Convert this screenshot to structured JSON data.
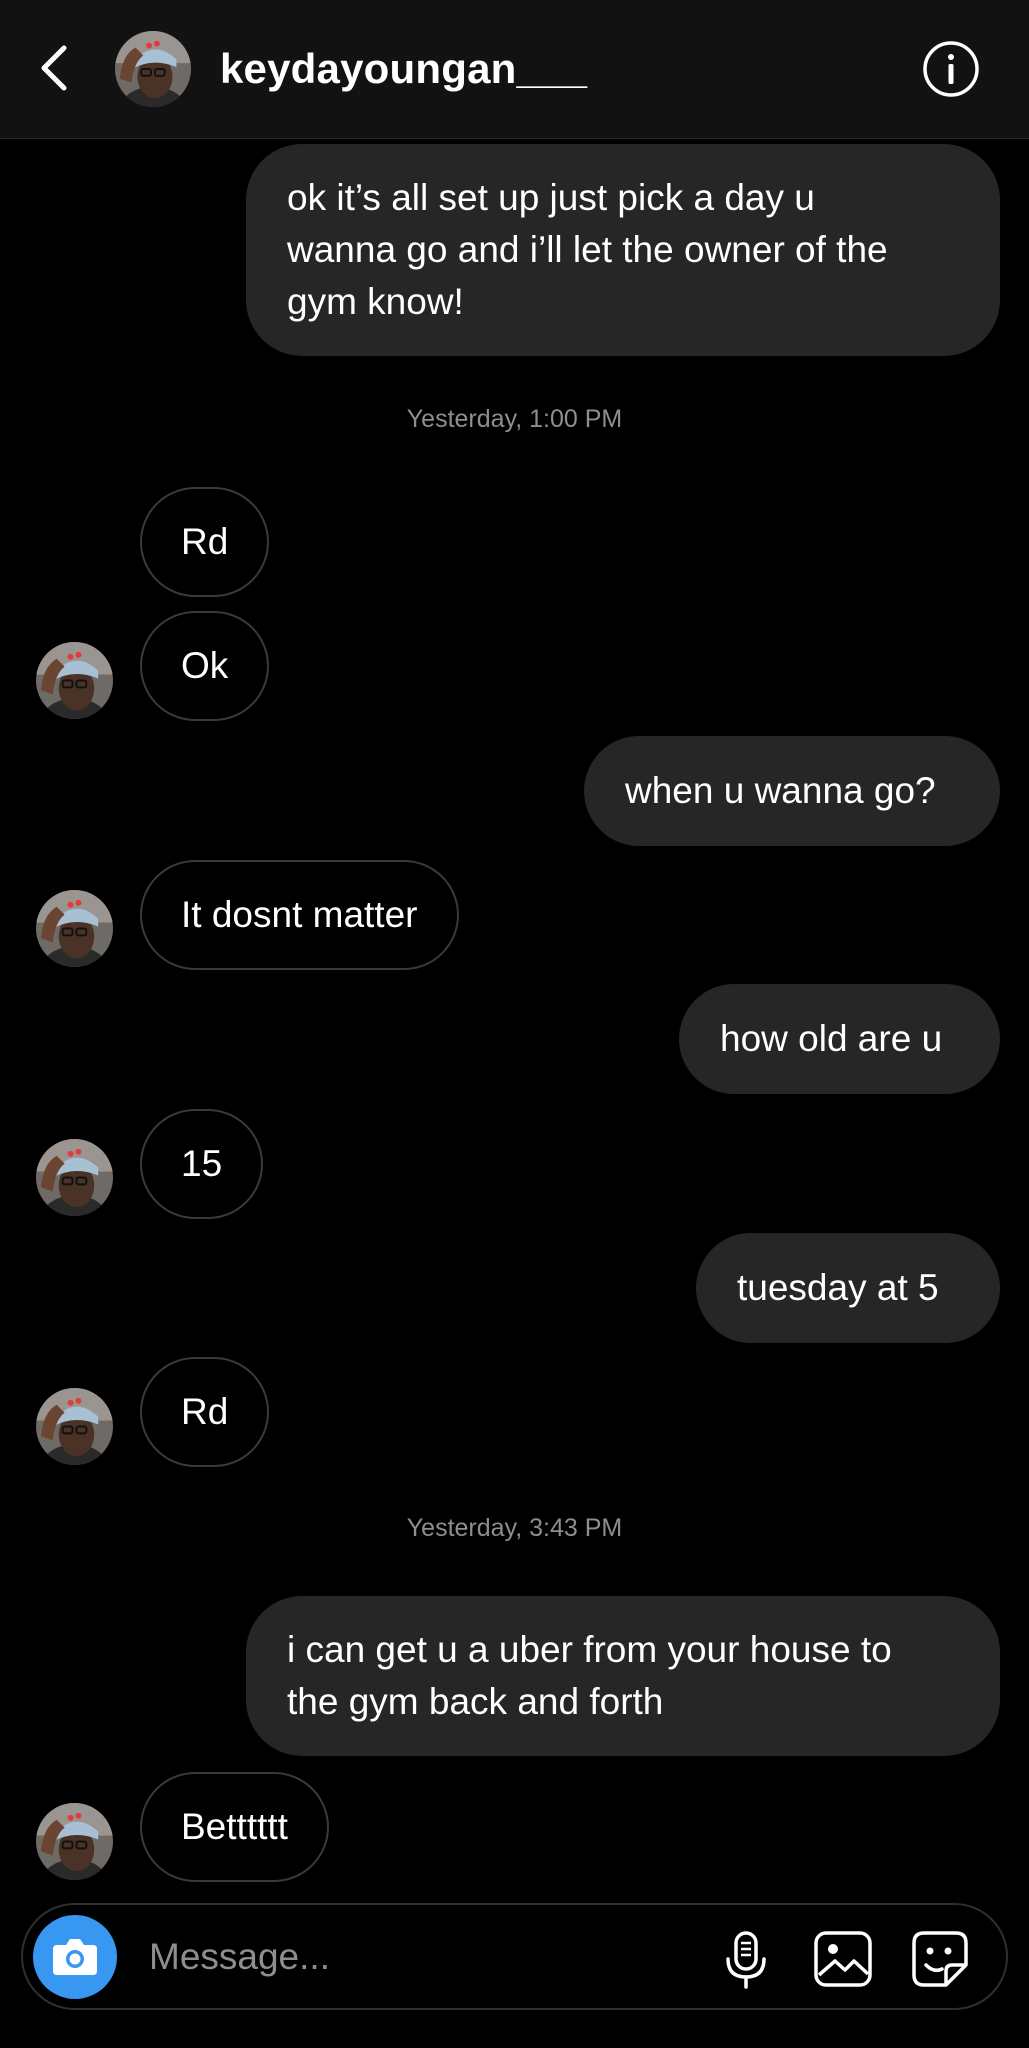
{
  "header": {
    "username": "keydayoungan___",
    "back_icon": "chevron-left-icon",
    "info_icon": "info-icon"
  },
  "thread": {
    "items": [
      {
        "type": "message",
        "direction": "outgoing",
        "lines": [
          "ok it’s all set up just pick a day u",
          "wanna go and i’ll let the owner of the",
          "gym know!"
        ]
      },
      {
        "type": "timestamp",
        "text": "Yesterday, 1:00 PM"
      },
      {
        "type": "message",
        "direction": "incoming",
        "text": "Rd"
      },
      {
        "type": "message",
        "direction": "incoming",
        "text": "Ok"
      },
      {
        "type": "message",
        "direction": "outgoing",
        "text": "when u wanna go?"
      },
      {
        "type": "message",
        "direction": "incoming",
        "text": "It dosnt matter"
      },
      {
        "type": "message",
        "direction": "outgoing",
        "text": "how old are u"
      },
      {
        "type": "message",
        "direction": "incoming",
        "text": "15"
      },
      {
        "type": "message",
        "direction": "outgoing",
        "text": "tuesday at 5"
      },
      {
        "type": "message",
        "direction": "incoming",
        "text": "Rd"
      },
      {
        "type": "timestamp",
        "text": "Yesterday, 3:43 PM"
      },
      {
        "type": "message",
        "direction": "outgoing",
        "lines": [
          "i can get u a uber from your house to",
          "the gym back and forth"
        ]
      },
      {
        "type": "message",
        "direction": "incoming",
        "text": "Betttttt"
      }
    ]
  },
  "composer": {
    "placeholder": "Message...",
    "icons": [
      "camera-icon",
      "microphone-icon",
      "gallery-icon",
      "sticker-icon"
    ]
  },
  "colors": {
    "background": "#000000",
    "header_background": "#121212",
    "outgoing_bubble": "#262626",
    "incoming_border": "#3a3a3a",
    "timestamp": "#8e8e8e",
    "camera_accent": "#3897f0"
  }
}
